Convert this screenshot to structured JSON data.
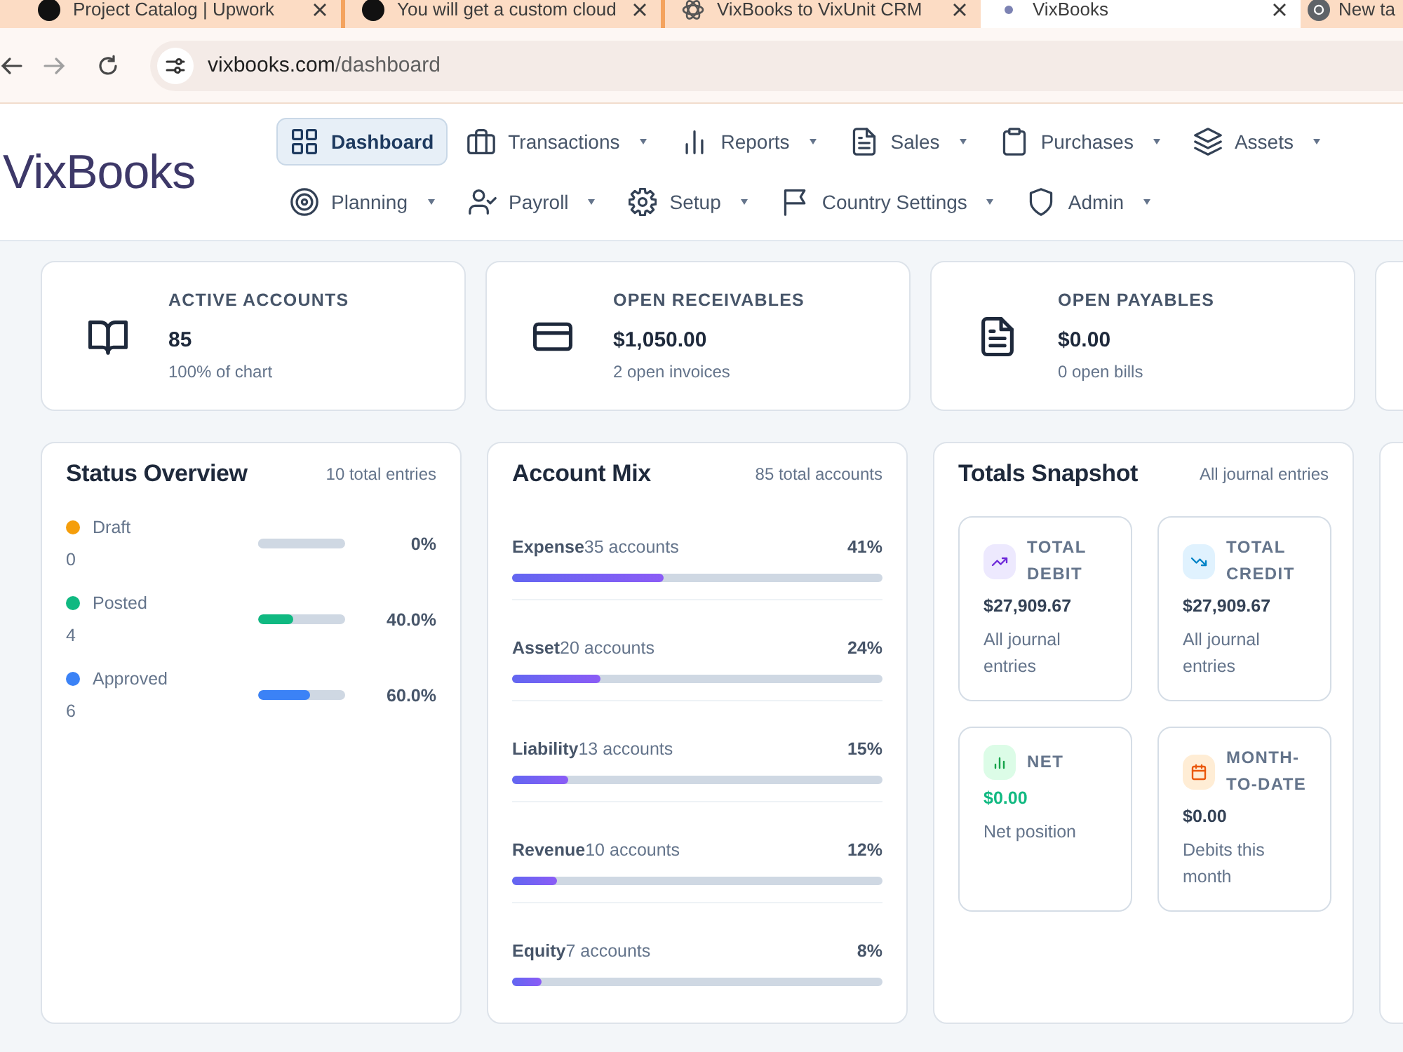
{
  "browser": {
    "tabs": [
      {
        "title": "Project Catalog | Upwork",
        "selected": false
      },
      {
        "title": "You will get a custom cloud",
        "selected": false
      },
      {
        "title": "VixBooks to VixUnit CRM",
        "selected": false
      },
      {
        "title": "VixBooks",
        "selected": true
      },
      {
        "title": "New ta",
        "selected": false
      }
    ],
    "address": {
      "host": "vixbooks.com",
      "path": "/dashboard"
    }
  },
  "header": {
    "logo": "VixBooks",
    "nav_rows": [
      {
        "items": [
          {
            "label": "Dashboard",
            "selected": true,
            "has_menu": false
          },
          {
            "label": "Transactions",
            "selected": false,
            "has_menu": true
          },
          {
            "label": "Reports",
            "selected": false,
            "has_menu": true
          },
          {
            "label": "Sales",
            "selected": false,
            "has_menu": true
          },
          {
            "label": "Purchases",
            "selected": false,
            "has_menu": true
          },
          {
            "label": "Assets",
            "selected": false,
            "has_menu": true
          }
        ]
      },
      {
        "items": [
          {
            "label": "Planning",
            "selected": false,
            "has_menu": true
          },
          {
            "label": "Payroll",
            "selected": false,
            "has_menu": true
          },
          {
            "label": "Setup",
            "selected": false,
            "has_menu": true
          },
          {
            "label": "Country Settings",
            "selected": false,
            "has_menu": true
          },
          {
            "label": "Admin",
            "selected": false,
            "has_menu": true
          }
        ]
      }
    ]
  },
  "stat_cards": [
    {
      "label": "ACTIVE ACCOUNTS",
      "value": "85",
      "note": "100% of chart"
    },
    {
      "label": "OPEN RECEIVABLES",
      "value": "$1,050.00",
      "note": "2 open invoices"
    },
    {
      "label": "OPEN PAYABLES",
      "value": "$0.00",
      "note": "0 open bills"
    }
  ],
  "status_overview": {
    "title": "Status Overview",
    "summary": "10 total entries",
    "items": [
      {
        "label": "Draft",
        "count": "0",
        "level": 0,
        "percent": "0%",
        "color": "#f59e0b"
      },
      {
        "label": "Posted",
        "count": "4",
        "level": 0.4,
        "percent": "40.0%",
        "color": "#10b981"
      },
      {
        "label": "Approved",
        "count": "6",
        "level": 0.6,
        "percent": "60.0%",
        "color": "#3b82f6"
      }
    ]
  },
  "account_mix": {
    "title": "Account Mix",
    "summary": "85 total accounts",
    "items": [
      {
        "name": "Expense",
        "count": "35 accounts",
        "share": "41%",
        "level": 0.41
      },
      {
        "name": "Asset",
        "count": "20 accounts",
        "share": "24%",
        "level": 0.24
      },
      {
        "name": "Liability",
        "count": "13 accounts",
        "share": "15%",
        "level": 0.15
      },
      {
        "name": "Revenue",
        "count": "10 accounts",
        "share": "12%",
        "level": 0.12
      },
      {
        "name": "Equity",
        "count": "7 accounts",
        "share": "8%",
        "level": 0.08
      }
    ]
  },
  "totals_snapshot": {
    "title": "Totals Snapshot",
    "summary": "All journal entries",
    "tiles": [
      {
        "kind": "debit",
        "label": "TOTAL DEBIT",
        "value": "$27,909.67",
        "note": "All journal entries"
      },
      {
        "kind": "credit",
        "label": "TOTAL CREDIT",
        "value": "$27,909.67",
        "note": "All journal entries"
      },
      {
        "kind": "net",
        "label": "NET",
        "value": "$0.00",
        "note": "Net position"
      },
      {
        "kind": "month",
        "label": "MONTH-TO-DATE",
        "value": "$0.00",
        "note": "Debits this month"
      }
    ]
  }
}
